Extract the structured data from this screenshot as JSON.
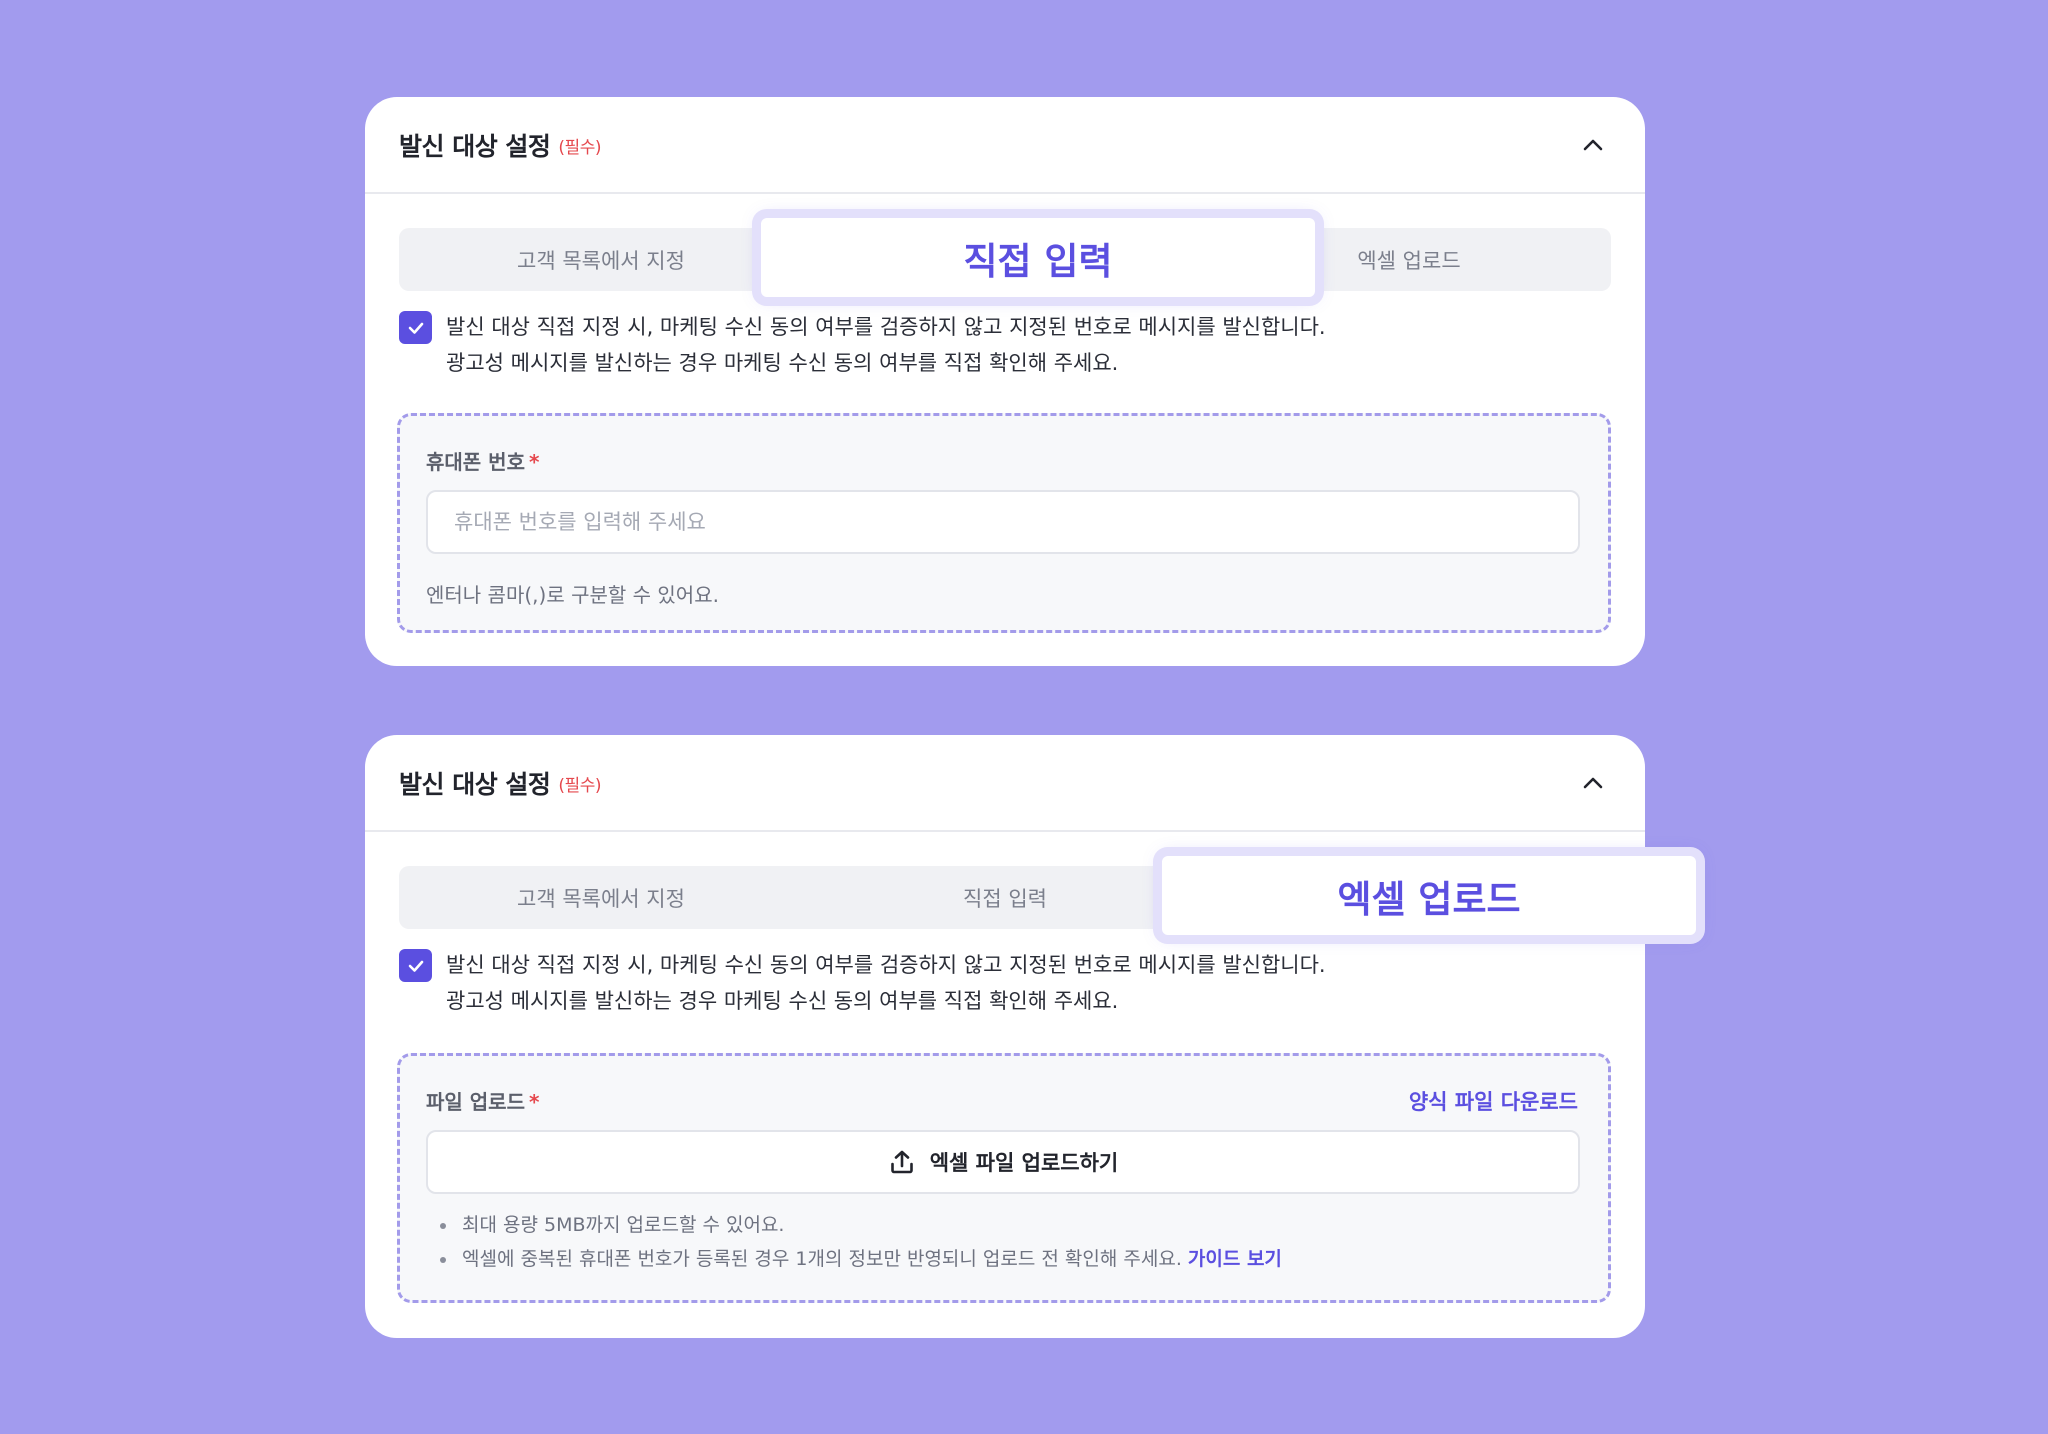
{
  "colors": {
    "background": "#a29bee",
    "accent": "#5b4fe0",
    "required": "#e5484d",
    "dashed_border": "#a39bea"
  },
  "panels": [
    {
      "title": "발신 대상 설정",
      "required_tag": "(필수)",
      "collapse_icon": "chevron-up-icon",
      "tabs": [
        "고객 목록에서 지정",
        "직접 입력",
        "엑셀 업로드"
      ],
      "active_tab": "직접 입력",
      "notice_checked": true,
      "notice_line1": "발신 대상 직접 지정 시, 마케팅 수신 동의 여부를 검증하지 않고 지정된 번호로 메시지를 발신합니다.",
      "notice_line2": "광고성 메시지를 발신하는 경우 마케팅 수신 동의 여부를 직접 확인해 주세요.",
      "field": {
        "label": "휴대폰 번호",
        "required_mark": "*",
        "placeholder": "휴대폰 번호를 입력해 주세요",
        "value": "",
        "hint": "엔터나 콤마(,)로 구분할 수 있어요."
      }
    },
    {
      "title": "발신 대상 설정",
      "required_tag": "(필수)",
      "collapse_icon": "chevron-up-icon",
      "tabs": [
        "고객 목록에서 지정",
        "직접 입력",
        "엑셀 업로드"
      ],
      "active_tab": "엑셀 업로드",
      "notice_checked": true,
      "notice_line1": "발신 대상 직접 지정 시, 마케팅 수신 동의 여부를 검증하지 않고 지정된 번호로 메시지를 발신합니다.",
      "notice_line2": "광고성 메시지를 발신하는 경우 마케팅 수신 동의 여부를 직접 확인해 주세요.",
      "field": {
        "label": "파일 업로드",
        "required_mark": "*",
        "template_link": "양식 파일 다운로드",
        "upload_label": "엑셀 파일 업로드하기",
        "upload_icon": "upload-icon",
        "bullets": [
          "최대 용량 5MB까지 업로드할 수 있어요.",
          "엑셀에 중복된 휴대폰 번호가 등록된 경우 1개의 정보만 반영되니 업로드 전 확인해 주세요."
        ],
        "guide_link": "가이드 보기"
      }
    }
  ]
}
